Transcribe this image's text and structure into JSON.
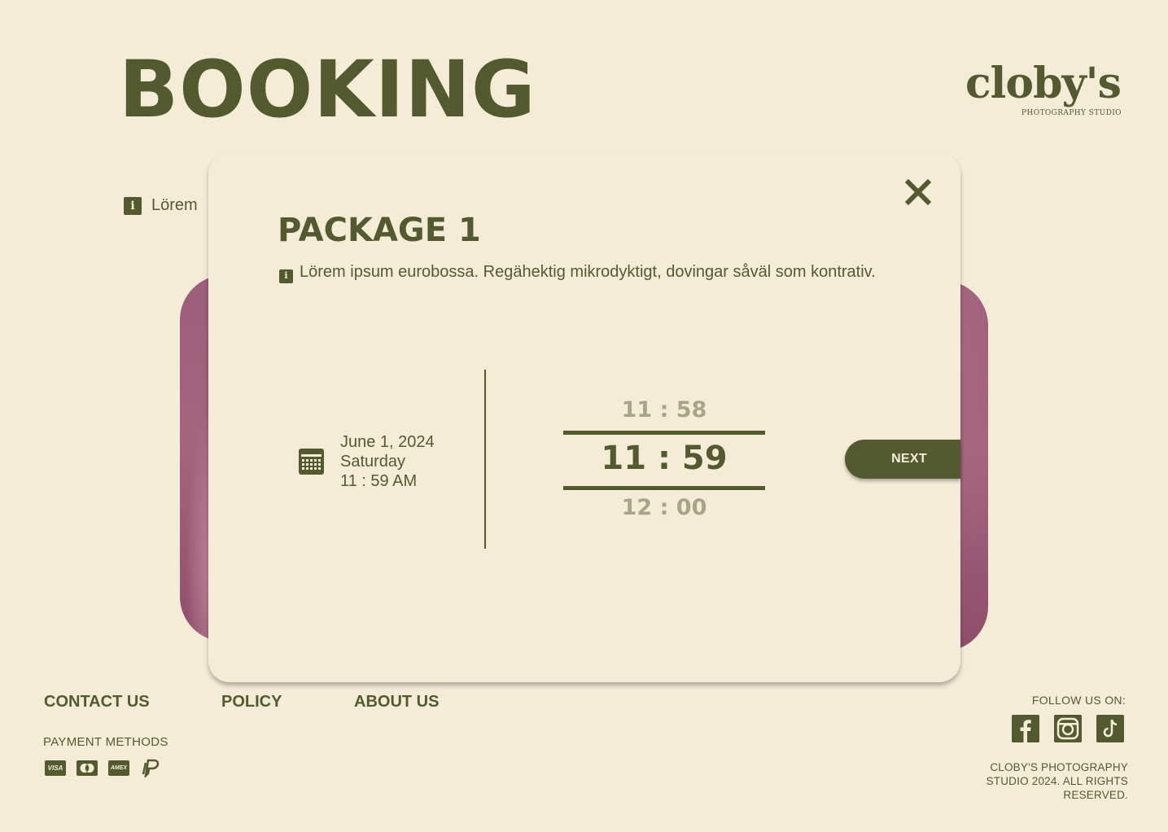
{
  "header": {
    "title": "BOOKING",
    "logo_text": "cloby's",
    "logo_subtitle": "PHOTOGRAPHY STUDIO"
  },
  "background": {
    "info_text": "Lörem"
  },
  "modal": {
    "title": "PACKAGE 1",
    "description": "Lörem ipsum eurobossa. Regähektig mikrodyktigt, dovingar såväl som kontrativ.",
    "selected_date": "June 1,  2024",
    "selected_day": "Saturday",
    "selected_time": "11 :  59 AM",
    "time_picker": {
      "previous": "11 : 58",
      "current": "11 : 59",
      "next": "12 : 00"
    },
    "next_label": "NEXT",
    "close_icon": "close-icon",
    "info_icon": "info-icon",
    "calendar_icon": "calendar-icon"
  },
  "footer": {
    "links": [
      "CONTACT US",
      "POLICY",
      "ABOUT US"
    ],
    "payment_label": "PAYMENT METHODS",
    "payment_icons": [
      "visa-icon",
      "mastercard-icon",
      "amex-icon",
      "paypal-icon"
    ],
    "payment_texts": [
      "VISA",
      "AMEX"
    ],
    "follow_label": "FOLLOW US ON:",
    "social_icons": [
      "facebook-icon",
      "instagram-icon",
      "tiktok-icon"
    ],
    "copyright": "CLOBY'S PHOTOGRAPHY STUDIO 2024. ALL RIGHTS RESERVED."
  },
  "colors": {
    "background": "#f5ecd8",
    "primary": "#545a30",
    "muted": "#a6a587",
    "photo_pink": "#9c5d7b"
  }
}
